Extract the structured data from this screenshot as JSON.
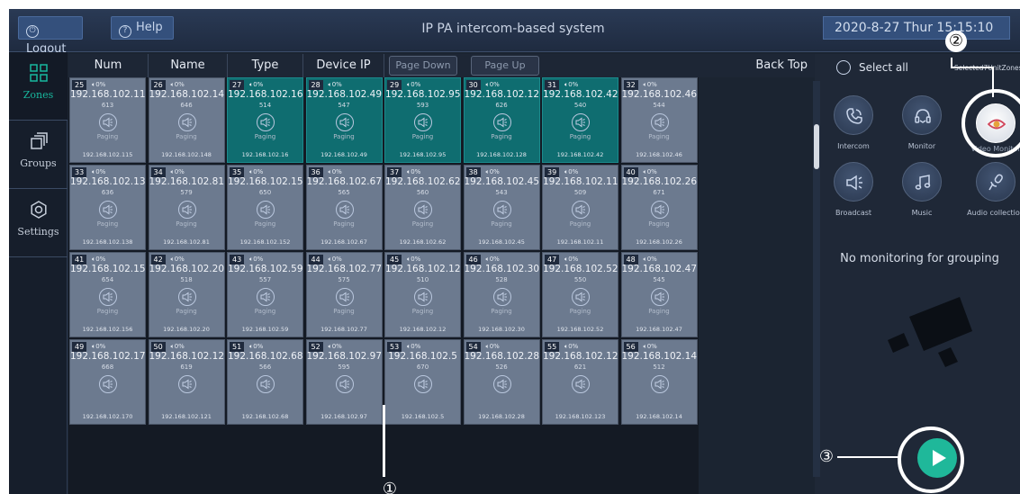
{
  "topbar": {
    "logout_label": "Logout",
    "help_label": "Help",
    "title": "IP PA intercom-based system",
    "datetime": "2020-8-27 Thur 15:15:10"
  },
  "nav": [
    {
      "label": "Zones",
      "icon": "grid-icon"
    },
    {
      "label": "Groups",
      "icon": "layers-icon"
    },
    {
      "label": "Settings",
      "icon": "gear-icon"
    }
  ],
  "header": {
    "num": "Num",
    "name": "Name",
    "type": "Type",
    "device_ip": "Device IP",
    "page_down": "Page Down",
    "page_up": "Page Up",
    "back_top": "Back Top"
  },
  "partial_row": [
    {
      "mode": "Paging",
      "ip": "192.168.102.144",
      "active": false
    },
    {
      "mode": "Paging",
      "ip": "192.168.102.56",
      "active": false
    },
    {
      "mode": "Paging",
      "ip": "192.168.2.148",
      "active": false
    },
    {
      "mode": "Paging",
      "ip": "192.168.102.22",
      "active": true
    },
    {
      "mode": "Paging",
      "ip": "192.168.102.64",
      "active": false
    },
    {
      "mode": "Paging",
      "ip": "192.168.102.109",
      "active": false
    },
    {
      "mode": "Paging",
      "ip": "192.168.102.54",
      "active": false
    },
    {
      "mode": "Paging",
      "ip": "192.168.102.65",
      "active": false
    }
  ],
  "zones": [
    {
      "num": "25",
      "volume": "0%",
      "ip": "192.168.102.115",
      "code": "613",
      "mode": "Paging",
      "active": false
    },
    {
      "num": "26",
      "volume": "0%",
      "ip": "192.168.102.148",
      "code": "646",
      "mode": "Paging",
      "active": false
    },
    {
      "num": "27",
      "volume": "0%",
      "ip": "192.168.102.16",
      "code": "514",
      "mode": "Paging",
      "active": true
    },
    {
      "num": "28",
      "volume": "0%",
      "ip": "192.168.102.49",
      "code": "547",
      "mode": "Paging",
      "active": true
    },
    {
      "num": "29",
      "volume": "0%",
      "ip": "192.168.102.95",
      "code": "593",
      "mode": "Paging",
      "active": true
    },
    {
      "num": "30",
      "volume": "0%",
      "ip": "192.168.102.128",
      "code": "626",
      "mode": "Paging",
      "active": true
    },
    {
      "num": "31",
      "volume": "0%",
      "ip": "192.168.102.42",
      "code": "540",
      "mode": "Paging",
      "active": true
    },
    {
      "num": "32",
      "volume": "0%",
      "ip": "192.168.102.46",
      "code": "544",
      "mode": "Paging",
      "active": false
    },
    {
      "num": "33",
      "volume": "0%",
      "ip": "192.168.102.138",
      "code": "636",
      "mode": "Paging",
      "active": false
    },
    {
      "num": "34",
      "volume": "0%",
      "ip": "192.168.102.81",
      "code": "579",
      "mode": "Paging",
      "active": false
    },
    {
      "num": "35",
      "volume": "0%",
      "ip": "192.168.102.152",
      "code": "650",
      "mode": "Paging",
      "active": false
    },
    {
      "num": "36",
      "volume": "0%",
      "ip": "192.168.102.67",
      "code": "565",
      "mode": "Paging",
      "active": false
    },
    {
      "num": "37",
      "volume": "0%",
      "ip": "192.168.102.62",
      "code": "560",
      "mode": "Paging",
      "active": false
    },
    {
      "num": "38",
      "volume": "0%",
      "ip": "192.168.102.45",
      "code": "543",
      "mode": "Paging",
      "active": false
    },
    {
      "num": "39",
      "volume": "0%",
      "ip": "192.168.102.11",
      "code": "509",
      "mode": "Paging",
      "active": false
    },
    {
      "num": "40",
      "volume": "0%",
      "ip": "192.168.102.26",
      "code": "671",
      "mode": "Paging",
      "active": false
    },
    {
      "num": "41",
      "volume": "0%",
      "ip": "192.168.102.156",
      "code": "654",
      "mode": "Paging",
      "active": false
    },
    {
      "num": "42",
      "volume": "0%",
      "ip": "192.168.102.20",
      "code": "518",
      "mode": "Paging",
      "active": false
    },
    {
      "num": "43",
      "volume": "0%",
      "ip": "192.168.102.59",
      "code": "557",
      "mode": "Paging",
      "active": false
    },
    {
      "num": "44",
      "volume": "0%",
      "ip": "192.168.102.77",
      "code": "575",
      "mode": "Paging",
      "active": false
    },
    {
      "num": "45",
      "volume": "0%",
      "ip": "192.168.102.12",
      "code": "510",
      "mode": "Paging",
      "active": false
    },
    {
      "num": "46",
      "volume": "0%",
      "ip": "192.168.102.30",
      "code": "528",
      "mode": "Paging",
      "active": false
    },
    {
      "num": "47",
      "volume": "0%",
      "ip": "192.168.102.52",
      "code": "550",
      "mode": "Paging",
      "active": false
    },
    {
      "num": "48",
      "volume": "0%",
      "ip": "192.168.102.47",
      "code": "545",
      "mode": "Paging",
      "active": false
    },
    {
      "num": "49",
      "volume": "0%",
      "ip": "192.168.102.170",
      "code": "668",
      "mode": "",
      "active": false
    },
    {
      "num": "50",
      "volume": "0%",
      "ip": "192.168.102.121",
      "code": "619",
      "mode": "",
      "active": false
    },
    {
      "num": "51",
      "volume": "0%",
      "ip": "192.168.102.68",
      "code": "566",
      "mode": "",
      "active": false
    },
    {
      "num": "52",
      "volume": "0%",
      "ip": "192.168.102.97",
      "code": "595",
      "mode": "",
      "active": false
    },
    {
      "num": "53",
      "volume": "0%",
      "ip": "192.168.102.5",
      "code": "670",
      "mode": "",
      "active": false
    },
    {
      "num": "54",
      "volume": "0%",
      "ip": "192.168.102.28",
      "code": "526",
      "mode": "",
      "active": false
    },
    {
      "num": "55",
      "volume": "0%",
      "ip": "192.168.102.123",
      "code": "621",
      "mode": "",
      "active": false
    },
    {
      "num": "56",
      "volume": "0%",
      "ip": "192.168.102.14",
      "code": "512",
      "mode": "",
      "active": false
    }
  ],
  "right_panel": {
    "select_all": "Select all",
    "selected_info": "Selected7UnitZones",
    "functions": [
      {
        "label": "Intercom",
        "icon": "phone-icon"
      },
      {
        "label": "Monitor",
        "icon": "headset-icon"
      },
      {
        "label": "Video Monitor",
        "icon": "eye-icon"
      },
      {
        "label": "Broadcast",
        "icon": "megaphone-icon"
      },
      {
        "label": "Music",
        "icon": "music-note-icon"
      },
      {
        "label": "Audio collection",
        "icon": "microphone-icon"
      }
    ],
    "monitor_status": "No monitoring for grouping",
    "play_icon": "play-icon"
  },
  "callouts": [
    "①",
    "②",
    "③"
  ],
  "colors": {
    "accent": "#1fb89a",
    "tile": "#6c7a8f",
    "tile_active": "#0f6d70",
    "bg": "#1b2431"
  }
}
